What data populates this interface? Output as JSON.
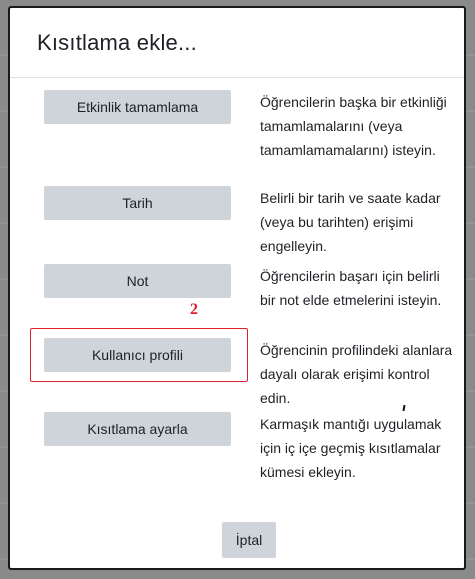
{
  "dialog": {
    "title": "Kısıtlama ekle..."
  },
  "options": [
    {
      "button_label": "Etkinlik tamamlama",
      "description": "Öğrencilerin başka bir etkinliği tamamlamalarını (veya tamamlamamalarını) isteyin."
    },
    {
      "button_label": "Tarih",
      "description": "Belirli bir tarih ve saate kadar (veya bu tarihten) erişimi engelleyin."
    },
    {
      "button_label": "Not",
      "description": "Öğrencilerin başarı için belirli bir not elde etmelerini isteyin."
    },
    {
      "button_label": "Kullanıcı profili",
      "description": "Öğrencinin profilindeki alanlara dayalı olarak erişimi kontrol edin."
    },
    {
      "button_label": "Kısıtlama ayarla",
      "description": "Karmaşık mantığı uygulamak için iç içe geçmiş kısıtlamalar kümesi ekleyin."
    }
  ],
  "annotation": {
    "label": "2",
    "color": "#e0202a"
  },
  "footer": {
    "cancel_label": "İptal"
  }
}
